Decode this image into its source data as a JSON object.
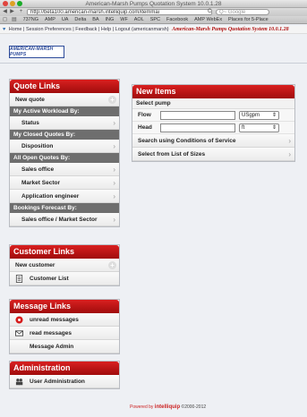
{
  "browser": {
    "title": "American-Marsh Pumps Quotation System 10.0.1.28",
    "url": "http://beta100.american-marsh.intelliquip.com/itemmai",
    "search_placeholder": "Q~ Google",
    "bookmarks": [
      "737NG",
      "AMP",
      "UA",
      "Delta",
      "BA",
      "ING",
      "WF",
      "AOL",
      "SPC",
      "Facebook",
      "AMP WebEx",
      "Places for 5-Place"
    ]
  },
  "topnav": {
    "links": [
      "Home",
      "Session Preferences",
      "Feedback",
      "Help",
      "Logout (americanmarsh)"
    ],
    "brand": "American-Marsh Pumps Quotation System 10.0.1.28"
  },
  "logo": {
    "text": "AMERICAN-MARSH PUMPS"
  },
  "quote_links": {
    "title": "Quote Links",
    "new_quote": "New quote",
    "sections": [
      {
        "header": "My Active Workload By:",
        "items": [
          "Status"
        ]
      },
      {
        "header": "My Closed Quotes By:",
        "items": [
          "Disposition"
        ]
      },
      {
        "header": "All Open Quotes By:",
        "items": [
          "Sales office",
          "Market Sector",
          "Application engineer"
        ]
      },
      {
        "header": "Bookings Forecast By:",
        "items": [
          "Sales office / Market Sector"
        ]
      }
    ]
  },
  "customer_links": {
    "title": "Customer Links",
    "new_customer": "New customer",
    "customer_list": "Customer List"
  },
  "message_links": {
    "title": "Message Links",
    "unread": "unread messages",
    "read": "read messages",
    "admin": "Message Admin"
  },
  "administration": {
    "title": "Administration",
    "user_admin": "User Administration"
  },
  "new_items": {
    "title": "New Items",
    "subtitle": "Select pump",
    "flow_label": "Flow",
    "flow_unit": "USgpm",
    "head_label": "Head",
    "head_unit": "ft",
    "search_conditions": "Search using Conditions of Service",
    "select_sizes": "Select from List of Sizes"
  },
  "footer": {
    "powered": "Powered by",
    "brand": "intelliquip",
    "copyright": "©2000-2012"
  },
  "colors": {
    "header_red": "#c41414",
    "section_gray": "#6e6e6e",
    "brand_blue": "#2d4b9a"
  }
}
